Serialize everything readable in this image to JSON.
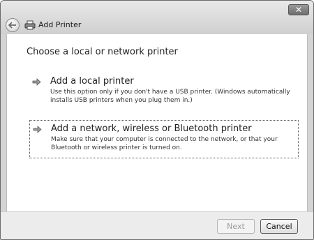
{
  "window": {
    "title": "Add Printer",
    "close_glyph": "✕"
  },
  "main": {
    "heading": "Choose a local or network printer",
    "options": [
      {
        "title": "Add a local printer",
        "description": "Use this option only if you don't have a USB printer. (Windows automatically installs USB printers when you plug them in.)",
        "icon": "arrow-right-icon"
      },
      {
        "title": "Add a network, wireless or Bluetooth printer",
        "description": "Make sure that your computer is connected to the network, or that your Bluetooth or wireless printer is turned on.",
        "icon": "arrow-right-icon"
      }
    ]
  },
  "footer": {
    "next_label": "Next",
    "cancel_label": "Cancel"
  }
}
